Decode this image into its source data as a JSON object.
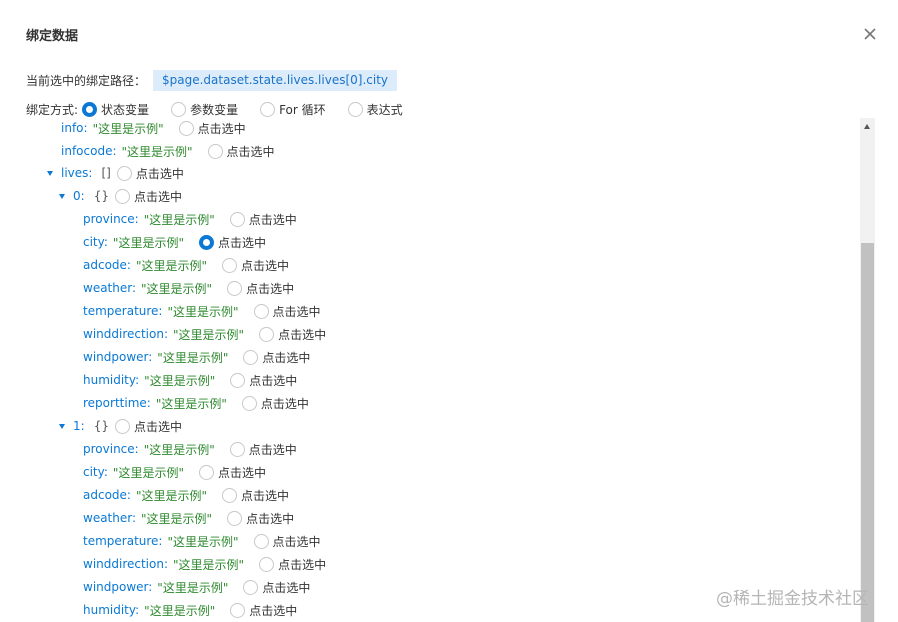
{
  "dialog": {
    "title": "绑定数据"
  },
  "path": {
    "label": "当前选中的绑定路径：",
    "value": "$page.dataset.state.lives.lives[0].city"
  },
  "mode": {
    "label": "绑定方式:",
    "options": [
      "状态变量",
      "参数变量",
      "For 循环",
      "表达式"
    ],
    "selected": "状态变量"
  },
  "select_label": "点击选中",
  "tree": {
    "info": {
      "key": "info:",
      "value": "\"这里是示例\""
    },
    "infocode": {
      "key": "infocode:",
      "value": "\"这里是示例\""
    },
    "lives": {
      "key": "lives:",
      "brace": "[]"
    },
    "item0": {
      "key": "0:",
      "brace": "{}",
      "fields": [
        {
          "key": "province:",
          "value": "\"这里是示例\""
        },
        {
          "key": "city:",
          "value": "\"这里是示例\""
        },
        {
          "key": "adcode:",
          "value": "\"这里是示例\""
        },
        {
          "key": "weather:",
          "value": "\"这里是示例\""
        },
        {
          "key": "temperature:",
          "value": "\"这里是示例\""
        },
        {
          "key": "winddirection:",
          "value": "\"这里是示例\""
        },
        {
          "key": "windpower:",
          "value": "\"这里是示例\""
        },
        {
          "key": "humidity:",
          "value": "\"这里是示例\""
        },
        {
          "key": "reporttime:",
          "value": "\"这里是示例\""
        }
      ]
    },
    "item1": {
      "key": "1:",
      "brace": "{}",
      "fields": [
        {
          "key": "province:",
          "value": "\"这里是示例\""
        },
        {
          "key": "city:",
          "value": "\"这里是示例\""
        },
        {
          "key": "adcode:",
          "value": "\"这里是示例\""
        },
        {
          "key": "weather:",
          "value": "\"这里是示例\""
        },
        {
          "key": "temperature:",
          "value": "\"这里是示例\""
        },
        {
          "key": "winddirection:",
          "value": "\"这里是示例\""
        },
        {
          "key": "windpower:",
          "value": "\"这里是示例\""
        },
        {
          "key": "humidity:",
          "value": "\"这里是示例\""
        }
      ]
    }
  },
  "selected_field": "item0.city",
  "watermark": "@稀土掘金技术社区",
  "colors": {
    "accent": "#0a78d4",
    "string_value": "#2f8a2f",
    "path_bg": "#dcecfb"
  }
}
